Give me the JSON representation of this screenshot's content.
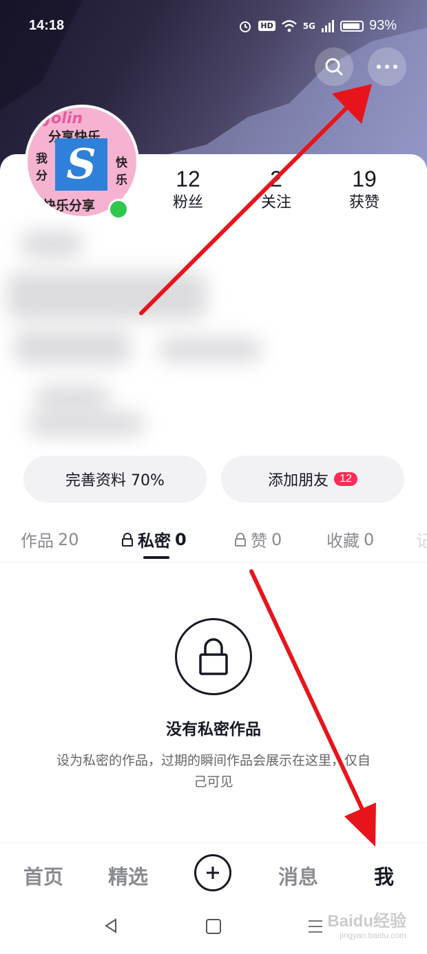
{
  "status_bar": {
    "time": "14:18",
    "hd": "HD",
    "signal": "5G",
    "battery": "93%"
  },
  "header": {
    "search_icon": "search-icon",
    "more_icon": "more-dots-icon"
  },
  "avatar": {
    "top_text": "Jolin",
    "line1": "分享快乐",
    "left_text": "我分",
    "right_text": "快乐",
    "bottom_text": "快乐分享",
    "logo_letter": "S"
  },
  "stats": [
    {
      "value": "12",
      "label": "粉丝"
    },
    {
      "value": "2",
      "label": "关注"
    },
    {
      "value": "19",
      "label": "获赞"
    }
  ],
  "actions": {
    "complete_profile": "完善资料 70%",
    "add_friend": "添加朋友",
    "add_friend_badge": "12"
  },
  "tabs": [
    {
      "label": "作品",
      "count": "20"
    },
    {
      "label": "私密",
      "count": "0"
    },
    {
      "label": "赞",
      "count": "0"
    },
    {
      "label": "收藏",
      "count": "0"
    },
    {
      "label": "记",
      "count": ""
    }
  ],
  "empty_state": {
    "title": "没有私密作品",
    "description": "设为私密的作品，过期的瞬间作品会展示在这里，仅自己可见"
  },
  "bottom_nav": {
    "home": "首页",
    "featured": "精选",
    "messages": "消息",
    "me": "我"
  },
  "watermark": {
    "brand": "Baidu经验",
    "url": "jingyan.baidu.com"
  },
  "colors": {
    "accent_red": "#fe2c55",
    "online_green": "#2dc84d",
    "arrow_red": "#e8141b"
  }
}
